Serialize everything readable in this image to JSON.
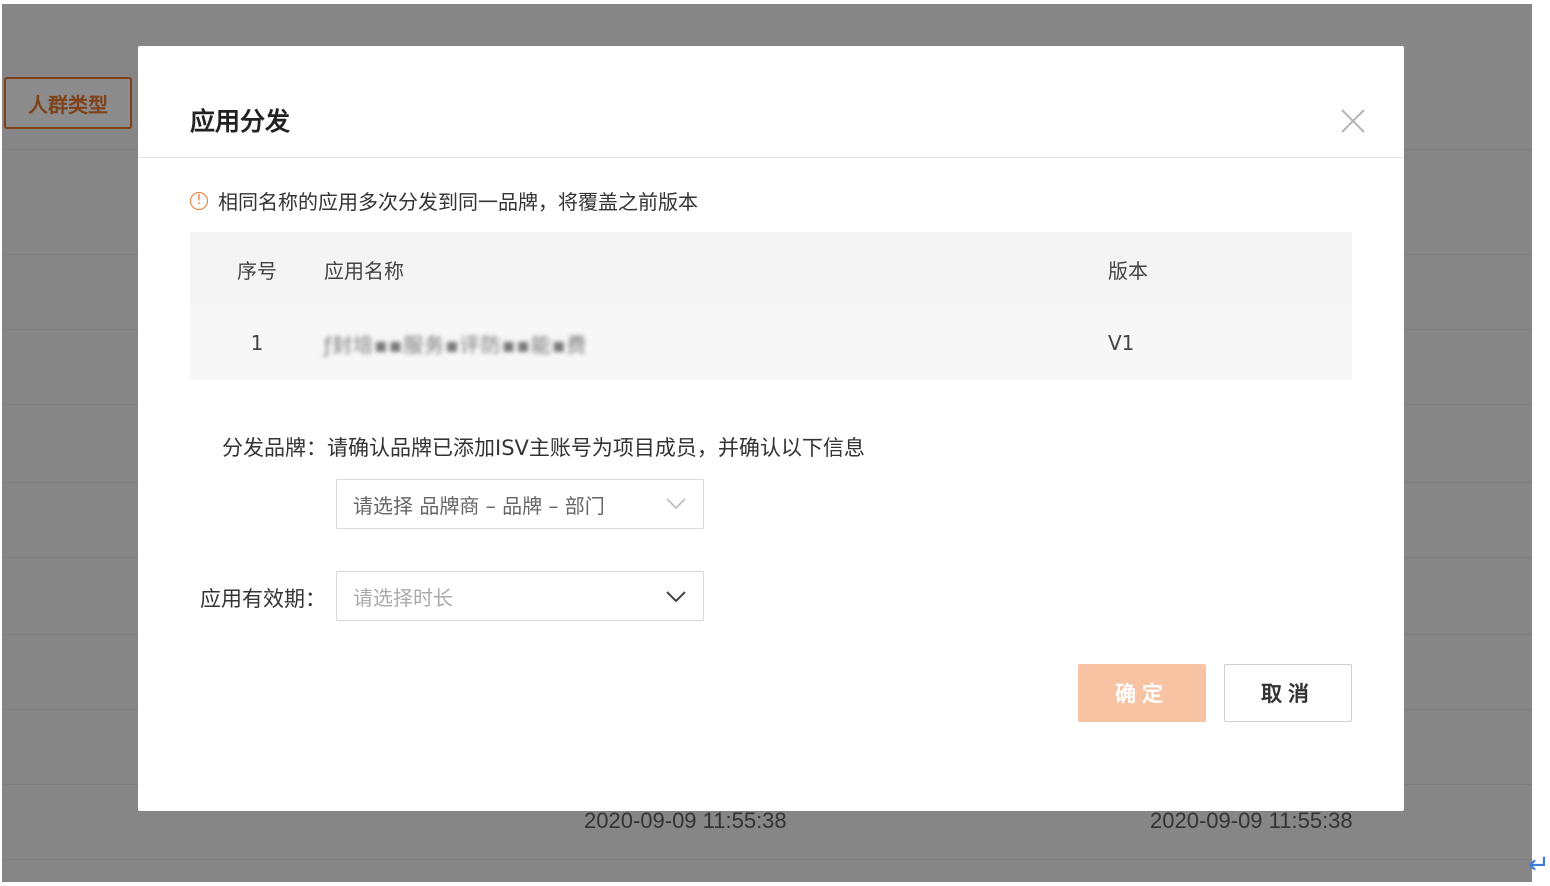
{
  "background": {
    "tag_label": "人群类型",
    "timestamps": [
      "2020-09-09 11:55:38",
      "2020-09-09 11:55:38"
    ],
    "return_symbol": "↵"
  },
  "modal": {
    "title": "应用分发",
    "notice_icon": "!",
    "notice": "相同名称的应用多次分发到同一品牌，将覆盖之前版本",
    "table": {
      "headers": [
        "序号",
        "应用名称",
        "版本"
      ],
      "rows": [
        {
          "no": "1",
          "name": "ƒ封培▪▪服务▪评防▪▪能▪费",
          "version": "V1"
        }
      ]
    },
    "brand": {
      "label": "分发品牌：",
      "hint": "请确认品牌已添加ISV主账号为项目成员，并确认以下信息",
      "placeholder": "请选择 品牌商 – 品牌 – 部门"
    },
    "validity": {
      "label": "应用有效期：",
      "placeholder": "请选择时长"
    },
    "buttons": {
      "ok": "确定",
      "cancel": "取消"
    }
  },
  "colors": {
    "accent": "#e8772e",
    "primary_disabled": "#f7c3a3",
    "mask": "rgba(0,0,0,0.45)"
  }
}
